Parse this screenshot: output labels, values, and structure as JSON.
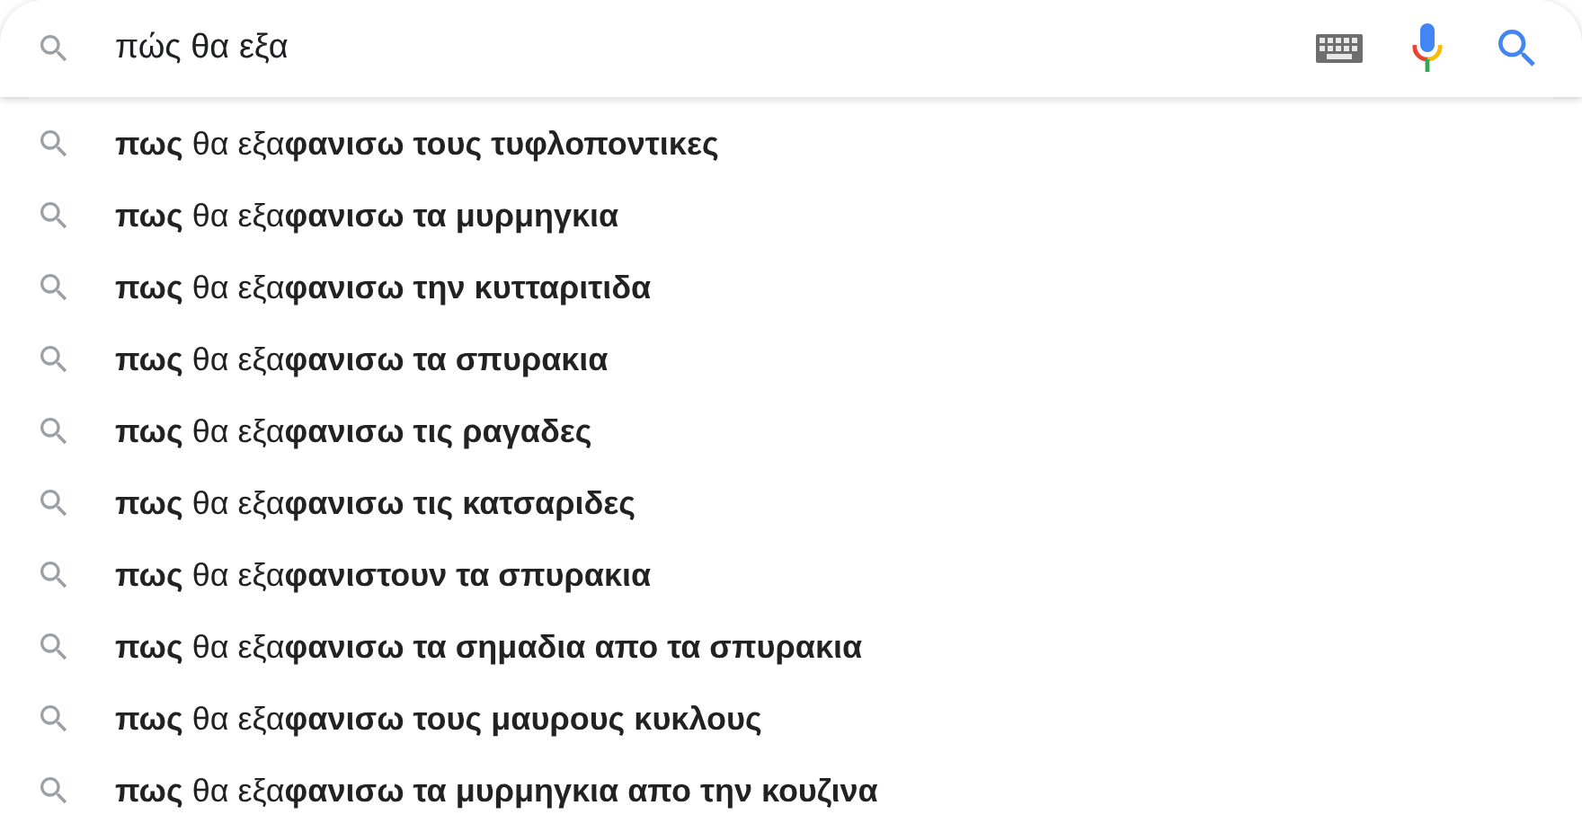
{
  "search": {
    "value": "πώς θα εξα"
  },
  "suggestions": [
    {
      "text": "**πως** θα εξα**φανισω τους τυφλοποντικες**"
    },
    {
      "text": "**πως** θα εξα**φανισω τα μυρμηγκια**"
    },
    {
      "text": "**πως** θα εξα**φανισω την κυτταριτιδα**"
    },
    {
      "text": "**πως** θα εξα**φανισω τα σπυρακια**"
    },
    {
      "text": "**πως** θα εξα**φανισω τις ραγαδες**"
    },
    {
      "text": "**πως** θα εξα**φανισω τις κατσαριδες**"
    },
    {
      "text": "**πως** θα εξα**φανιστουν τα σπυρακια**"
    },
    {
      "text": "**πως** θα εξα**φανισω τα σημαδια απο τα σπυρακια**"
    },
    {
      "text": "**πως** θα εξα**φανισω τους μαυρους κυκλους**"
    },
    {
      "text": "**πως** θα εξα**φανισω τα μυρμηγκια απο την κουζινα**"
    }
  ]
}
